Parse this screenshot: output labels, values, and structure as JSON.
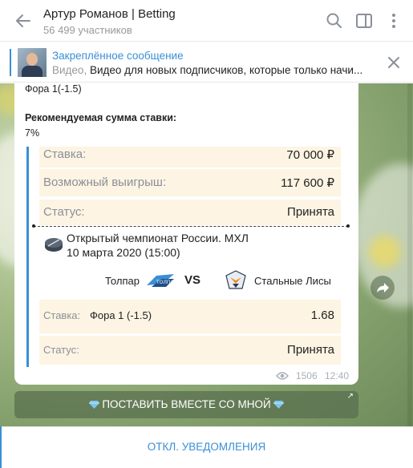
{
  "header": {
    "title": "Артур Романов | Betting",
    "subtitle": "56 499 участников"
  },
  "pinned": {
    "title": "Закреплённое сообщение",
    "label": "Видео,",
    "text": "Видео для новых подписчиков, которые только начи..."
  },
  "message": {
    "line1": "Фора 1(-1.5)",
    "recommend_label": "Рекомендуемая сумма ставки:",
    "recommend_value": "7%",
    "bet_label": "Ставка:",
    "bet_amount": "70 000 ₽",
    "win_label": "Возможный выигрыш:",
    "win_amount": "117 600 ₽",
    "status_label": "Статус:",
    "status_value": "Принята",
    "championship": "Открытый чемпионат России. МХЛ",
    "date": "10 марта 2020 (15:00)",
    "team1": "Толпар",
    "vs": "VS",
    "team2": "Стальные Лисы",
    "stake_label": "Ставка:",
    "stake_value": "Фора 1 (-1.5)",
    "odds": "1.68",
    "status2_label": "Статус:",
    "status2_value": "Принята",
    "views": "1506",
    "time": "12:40"
  },
  "inline_button": {
    "label": "ПОСТАВИТЬ ВМЕСТЕ СО МНОЙ"
  },
  "footer": {
    "notify_label": "ОТКЛ. УВЕДОМЛЕНИЯ"
  },
  "colors": {
    "accent": "#3a8fd6",
    "row_bg": "#fdf4e3"
  }
}
